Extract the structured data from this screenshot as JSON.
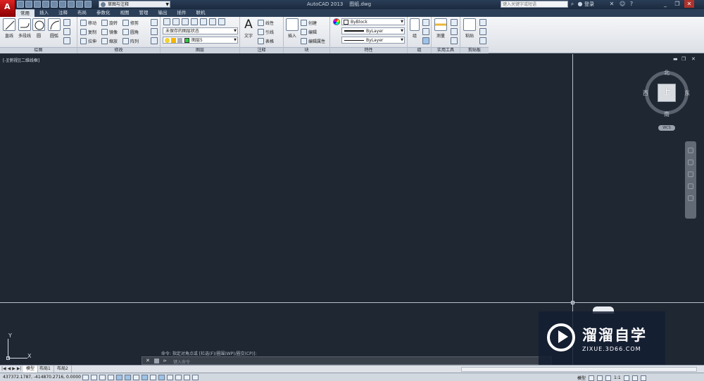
{
  "titlebar": {
    "workspace": "草图与注释",
    "app_title": "AutoCAD 2013",
    "file_name": "图纸.dwg",
    "search_placeholder": "键入关键字或短语",
    "login": "登录"
  },
  "tabs": [
    "常用",
    "插入",
    "注释",
    "布局",
    "参数化",
    "视图",
    "管理",
    "输出",
    "插件",
    "联机"
  ],
  "active_tab": "常用",
  "ribbon": {
    "draw": {
      "title": "绘图",
      "line": "直线",
      "polyline": "多段线",
      "circle": "圆",
      "arc": "圆弧"
    },
    "modify": {
      "title": "修改",
      "move": "移动",
      "rotate": "旋转",
      "trim": "修剪",
      "copy": "复制",
      "mirror": "镜像",
      "fillet": "圆角",
      "stretch": "拉伸",
      "scale": "缩放",
      "array": "阵列"
    },
    "layers": {
      "title": "图层",
      "state": "未保存的图层状态",
      "layer": "图层5"
    },
    "annotation": {
      "title": "注释",
      "text": "文字",
      "linear": "线性",
      "leader": "引线",
      "table": "表格"
    },
    "block": {
      "title": "块",
      "insert": "插入",
      "create": "创建",
      "edit": "编辑",
      "edit_attr": "编辑属性"
    },
    "properties": {
      "title": "特性",
      "color": "ByBlock",
      "lineweight": "ByLayer",
      "linetype": "ByLayer"
    },
    "groups": {
      "title": "组",
      "group": "组"
    },
    "utilities": {
      "title": "实用工具",
      "measure": "测量"
    },
    "clipboard": {
      "title": "剪贴板",
      "paste": "粘贴"
    }
  },
  "viewport": {
    "label": "[-][俯视][二维线框]",
    "compass": {
      "north": "北",
      "south": "南",
      "east": "东",
      "west": "西",
      "top": "上"
    },
    "wcs": "WCS",
    "ucs": {
      "x": "X",
      "y": "Y"
    }
  },
  "command": {
    "history": "命令: 指定对角点或 [栏选(F)/圈围(WP)/圈交(CP)]:",
    "prompt": "⊳",
    "placeholder": "键入命令"
  },
  "watermark": {
    "title": "溜溜自学",
    "url": "ZIXUE.3D66.COM"
  },
  "layout_tabs": [
    "模型",
    "布局1",
    "布局2"
  ],
  "status": {
    "coords": "437372.1787, -414870.2716, 0.0000",
    "model": "模型",
    "scale": "1:1"
  }
}
